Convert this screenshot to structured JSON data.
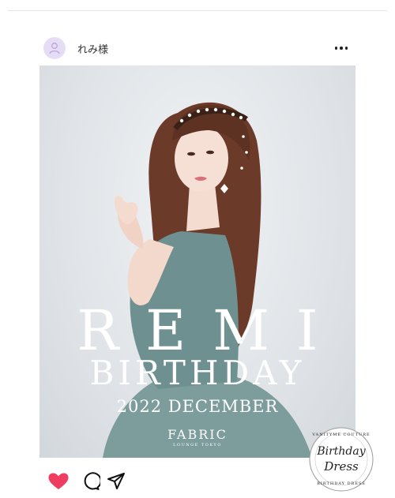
{
  "post": {
    "username": "れみ様",
    "more_label": "More options"
  },
  "image": {
    "title_line1": "REMI",
    "title_line2": "BIRTHDAY",
    "title_line3": "2022 DECEMBER",
    "brand": "FABRIC",
    "brand_sub": "LOUNGE TOKYO"
  },
  "badge": {
    "top_arc": "VANITYME COUTURE",
    "line1": "Birthday",
    "line2": "Dress",
    "bottom_arc": "BIRTHDAY DRESS"
  },
  "actions": {
    "like": "heart-icon",
    "comment": "comment-icon",
    "share": "send-icon"
  },
  "colors": {
    "like_active": "#ee3d5f",
    "avatar_bg": "#e7dcf6",
    "image_bg": "#dde1e5",
    "dress": "#6f9090",
    "hair": "#6b3a29"
  }
}
